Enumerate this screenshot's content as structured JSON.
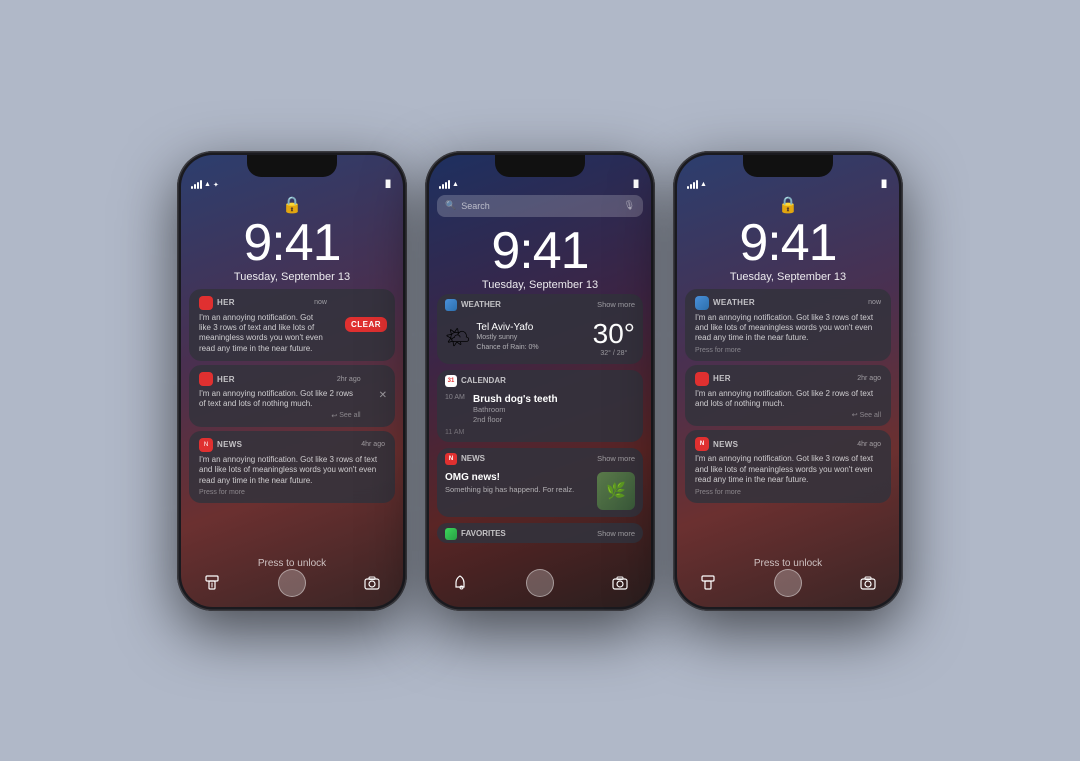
{
  "background_color": "#b0b8c8",
  "phones": [
    {
      "id": "phone-left",
      "type": "lock-swipe",
      "time": "9:41",
      "date": "Tuesday, September 13",
      "notifications": [
        {
          "app": "HER",
          "app_color": "#e03030",
          "time": "now",
          "body": "I'm an annoying notification. Got like 3 rows of text and like lots of meaningless words you won't even read any time in the near future.",
          "swiped": true,
          "show_clear": true,
          "action": ""
        },
        {
          "app": "HER",
          "app_color": "#e03030",
          "time": "2hr ago",
          "body": "I'm an annoying notification. Got like 2 rows of text and lots of nothing much.",
          "swiped": true,
          "show_clear": false,
          "action": "See all"
        },
        {
          "app": "NEWS",
          "app_color": "#e03030",
          "time": "4hr ago",
          "body": "I'm an annoying notification. Got like 3 rows of text and like lots of meaningless words you won't even read any time in the near future.",
          "swiped": false,
          "show_clear": false,
          "action": "Press for more"
        }
      ],
      "bottom_text": "Press to unlock",
      "bottom_left_icon": "list-icon",
      "bottom_right_icon": "camera-icon"
    },
    {
      "id": "phone-middle",
      "type": "notification-center",
      "time": "9:41",
      "date": "Tuesday, September 13",
      "search_placeholder": "Search",
      "widgets": [
        {
          "type": "weather",
          "app_name": "WEATHER",
          "show_more": "Show more",
          "city": "Tel Aviv-Yafo",
          "description": "Mostly sunny",
          "rain": "Chance of Rain: 0%",
          "temp": "30°",
          "range": "32° / 28°"
        },
        {
          "type": "calendar",
          "app_name": "CALENDAR",
          "event_title": "Brush dog's teeth",
          "event_time": "10 AM",
          "event_location": "Bathroom",
          "event_floor": "2nd floor",
          "next_time": "11 AM"
        },
        {
          "type": "news",
          "app_name": "NEWS",
          "show_more": "Show more",
          "title": "OMG news!",
          "body": "Something big has happend. For realz."
        },
        {
          "type": "favorites",
          "app_name": "FAVORITES",
          "show_more": "Show more"
        }
      ],
      "bottom_left_icon": "bell-icon",
      "bottom_right_icon": "camera-icon"
    },
    {
      "id": "phone-right",
      "type": "lock-notifications",
      "time": "9:41",
      "date": "Tuesday, September 13",
      "notifications": [
        {
          "app": "WEATHER",
          "app_color": "#4a90d9",
          "time": "now",
          "body": "I'm an annoying notification. Got like 3 rows of text and like lots of meaningless words you won't even read any time in the near future.",
          "action": "Press for more"
        },
        {
          "app": "HER",
          "app_color": "#e03030",
          "time": "2hr ago",
          "body": "I'm an annoying notification. Got like 2 rows of text and lots of nothing much.",
          "action": "See all"
        },
        {
          "app": "NEWS",
          "app_color": "#e03030",
          "time": "4hr ago",
          "body": "I'm an annoying notification. Got like 3 rows of text and like lots of meaningless words you won't even read any time in the near future.",
          "action": "Press for more"
        }
      ],
      "bottom_text": "Press to unlock",
      "bottom_left_icon": "grid-icon",
      "bottom_right_icon": "camera-icon"
    }
  ],
  "labels": {
    "clear": "CLEAR",
    "press_more": "Press for more",
    "see_all": "See all",
    "press_unlock": "Press to unlock",
    "show_more": "Show more"
  }
}
